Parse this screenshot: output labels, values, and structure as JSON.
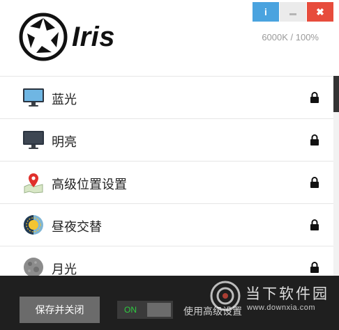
{
  "header": {
    "logo_text": "Iris",
    "temperature_readout": "6000K / 100%"
  },
  "window_buttons": {
    "info": "i",
    "close": "✖"
  },
  "modes": [
    {
      "label": "蓝光",
      "icon": "monitor-blue-icon",
      "locked": true
    },
    {
      "label": "明亮",
      "icon": "monitor-dark-icon",
      "locked": true
    },
    {
      "label": "高级位置设置",
      "icon": "map-pin-icon",
      "locked": true
    },
    {
      "label": "昼夜交替",
      "icon": "day-night-icon",
      "locked": true
    },
    {
      "label": "月光",
      "icon": "moon-icon",
      "locked": true
    }
  ],
  "footer": {
    "save_label": "保存并关闭",
    "toggle_label": "ON",
    "advanced_label": "使用高级设置"
  },
  "watermark": {
    "name": "当下软件园",
    "url": "www.downxia.com"
  },
  "colors": {
    "info": "#4aa3df",
    "close": "#e74c3c",
    "footer_bg": "#1f1f1f",
    "toggle_on": "#2ecc40"
  }
}
